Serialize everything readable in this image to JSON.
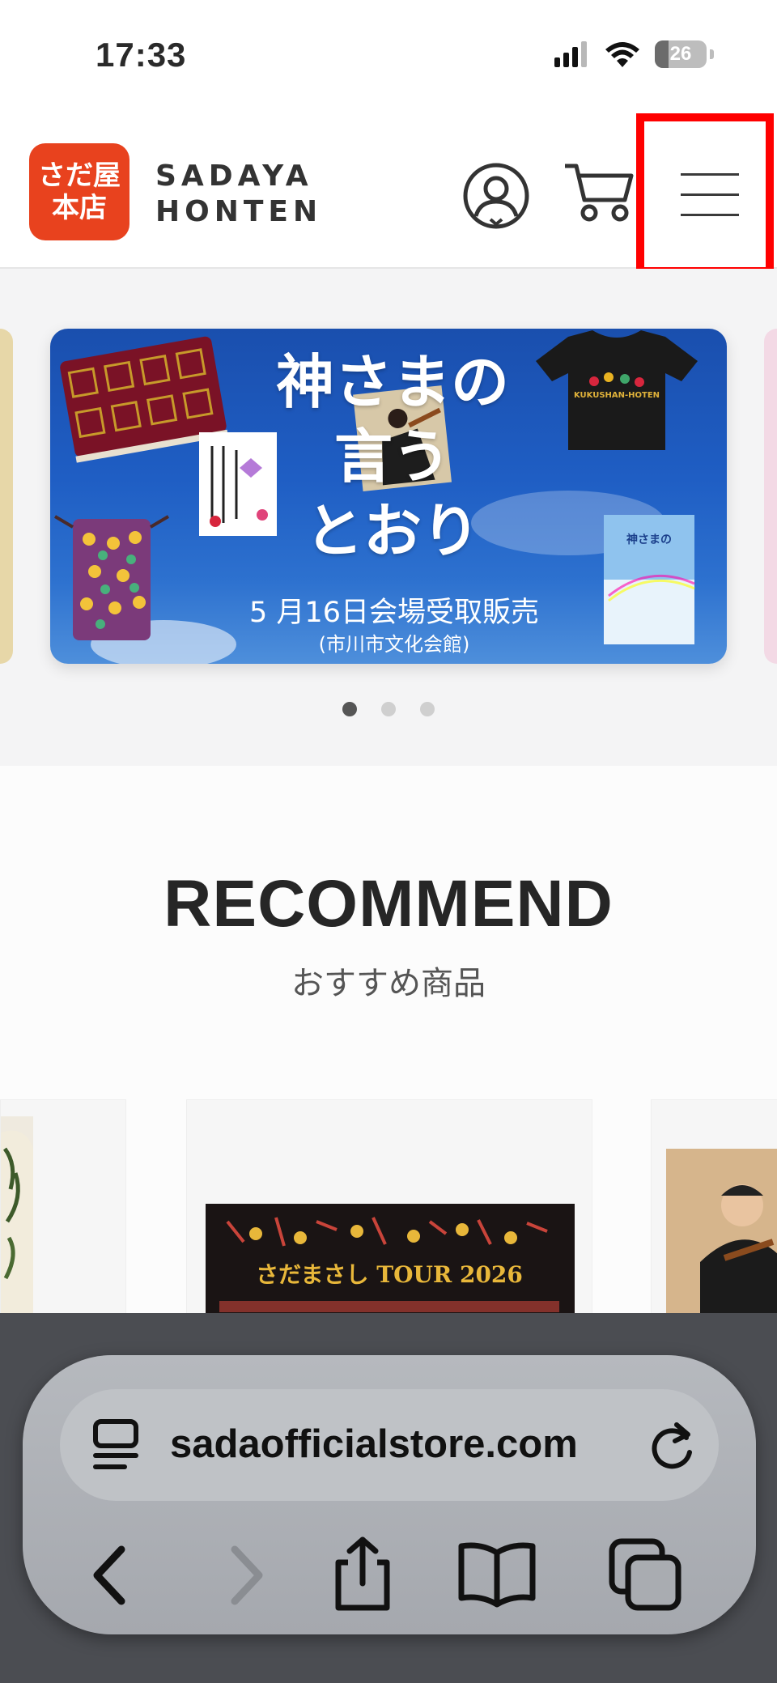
{
  "status_bar": {
    "time": "17:33",
    "battery": "26"
  },
  "header": {
    "logo_mark_line1": "さだ屋",
    "logo_mark_line2": "本店",
    "logo_text_line1": "SADAYA",
    "logo_text_line2": "HONTEN"
  },
  "hero_banner": {
    "title_line1": "神さまの",
    "title_line2": "言う",
    "title_line3": "とおり",
    "caption": "5 月16日会場受取販売",
    "sub_caption": "(市川市文化会館)",
    "tshirt_print": "KUKUSHAN-HOTEN",
    "product_label": "さだまさし TOUR 2026",
    "slide_count": 3,
    "active_slide": 1
  },
  "recommend": {
    "title": "RECOMMEND",
    "subtitle": "おすすめ商品"
  },
  "safari": {
    "url": "sadaofficialstore.com"
  },
  "colors": {
    "brand_orange": "#e8421e",
    "highlight_red": "#ff0000",
    "banner_blue": "#1f5ec4"
  }
}
